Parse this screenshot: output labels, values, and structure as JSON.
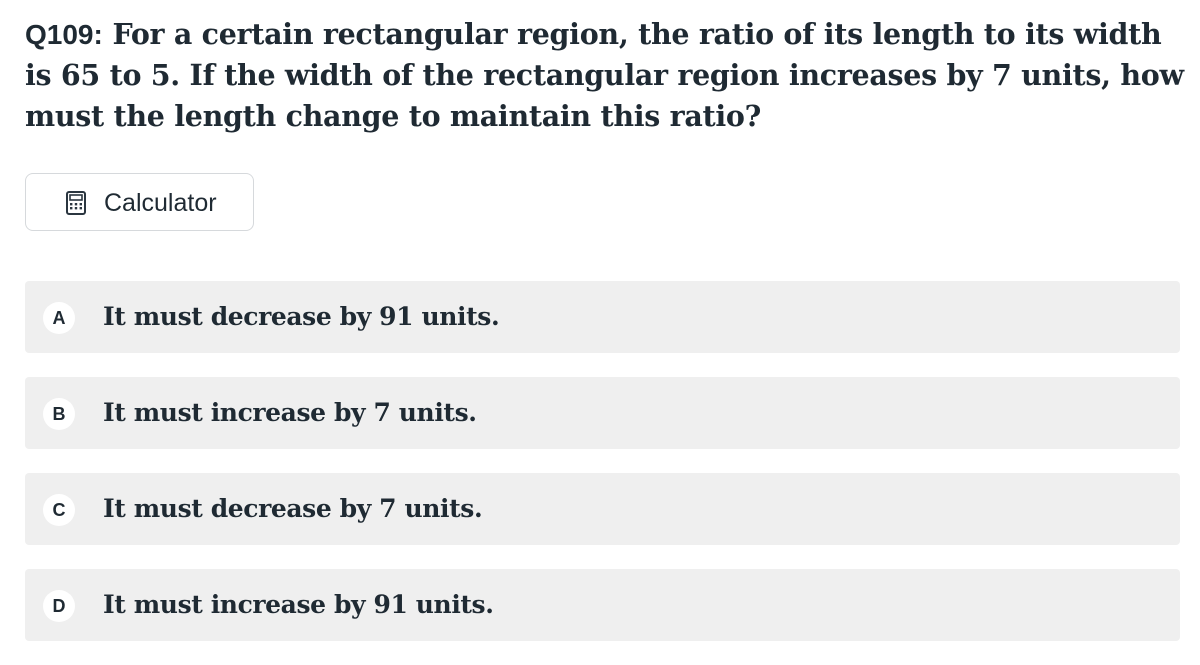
{
  "question": {
    "number": "Q109:",
    "text": "For a certain rectangular region, the ratio of its length to its width is 65 to 5. If the width of the rectangular region increases by 7 units, how must the length change to maintain this ratio?"
  },
  "calculator": {
    "label": "Calculator",
    "icon": "calculator-icon"
  },
  "options": [
    {
      "letter": "A",
      "text": "It must decrease by 91 units."
    },
    {
      "letter": "B",
      "text": "It must increase by 7 units."
    },
    {
      "letter": "C",
      "text": "It must decrease by 7 units."
    },
    {
      "letter": "D",
      "text": "It must increase by 91 units."
    }
  ],
  "colors": {
    "text": "#1f2a33",
    "option_bg": "#efefef",
    "border": "#d6d9dc",
    "background": "#ffffff"
  }
}
